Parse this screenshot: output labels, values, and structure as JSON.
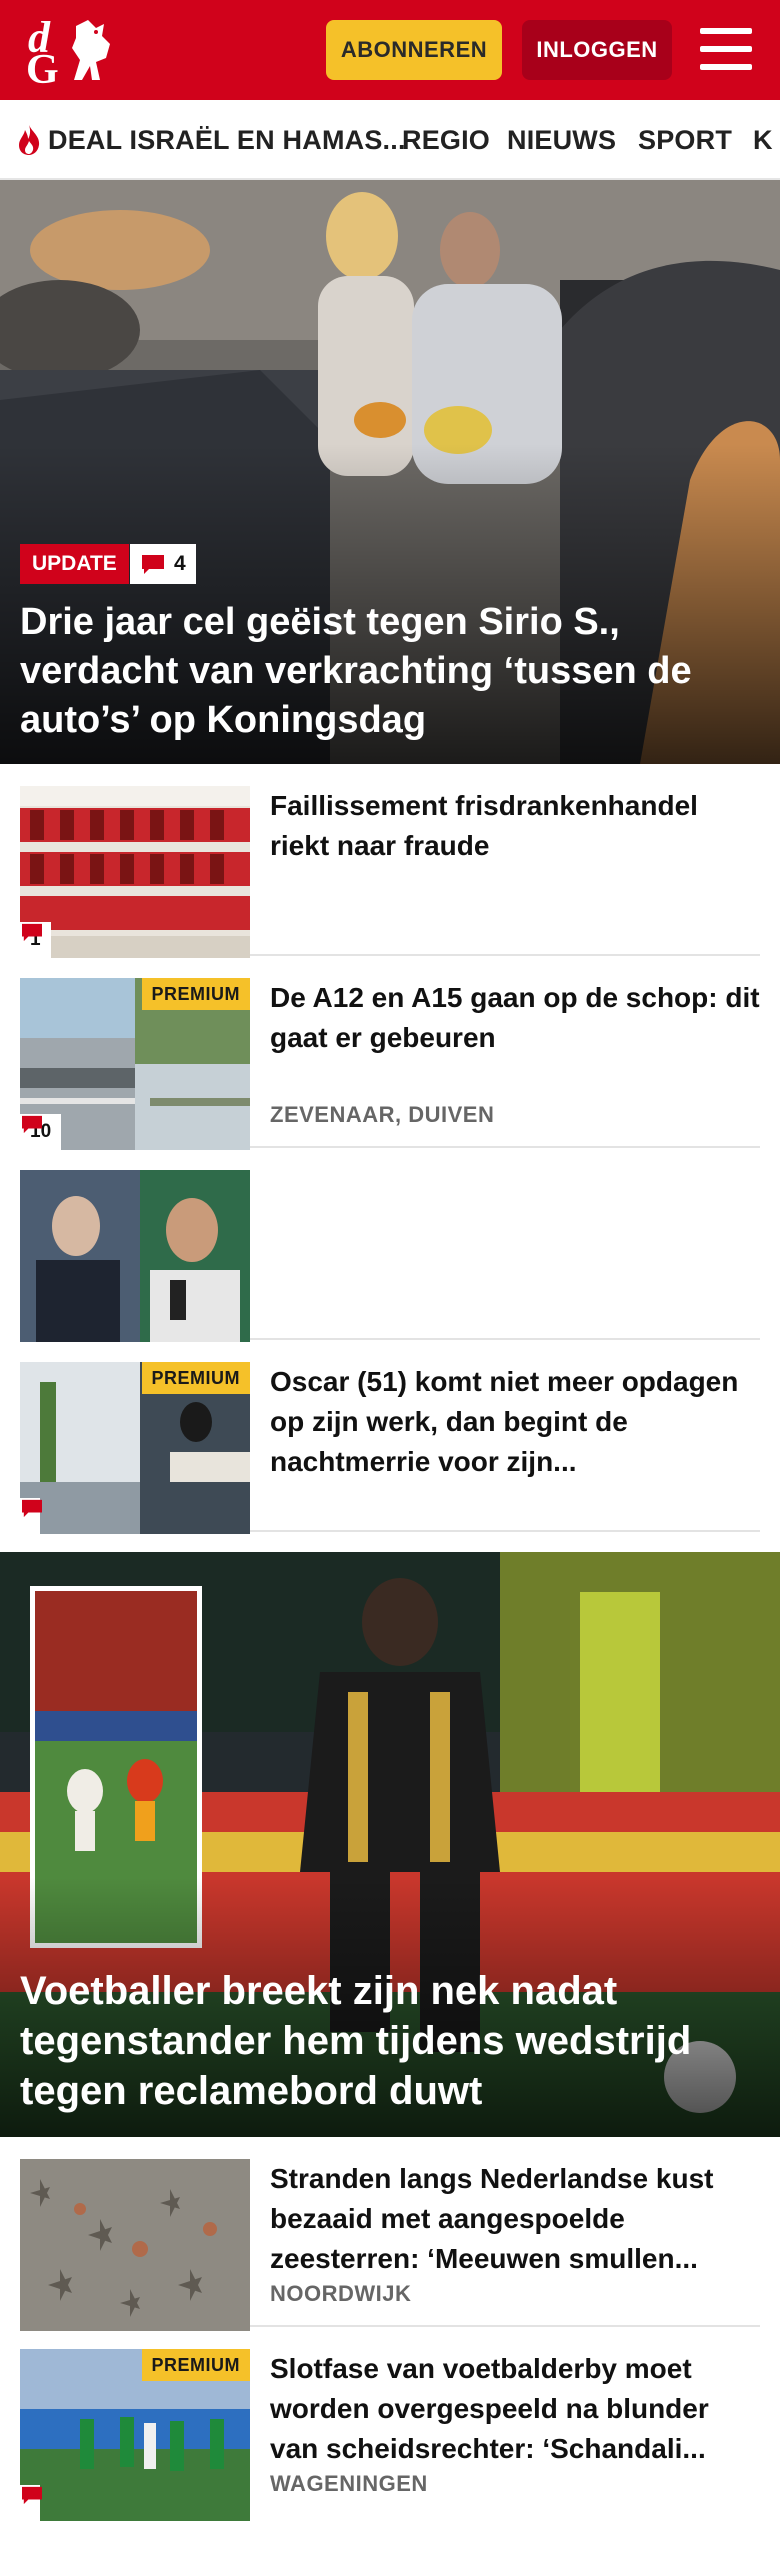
{
  "header": {
    "logo_letters": "dG",
    "subscribe_label": "ABONNEREN",
    "login_label": "INLOGGEN"
  },
  "nav": {
    "items": [
      {
        "label": "DEAL ISRAËL EN HAMAS..."
      },
      {
        "label": "REGIO"
      },
      {
        "label": "NIEUWS"
      },
      {
        "label": "SPORT"
      },
      {
        "label": "K"
      }
    ]
  },
  "hero": {
    "badge": "UPDATE",
    "comments": "4",
    "title": "Drie jaar cel geëist tegen Sirio S., verdacht van verkrachting ‘tussen de auto’s’ op Koningsdag"
  },
  "articles": [
    {
      "title": "Faillissement frisdrankenhandel riekt naar fraude",
      "comments": "1",
      "premium": "",
      "location": ""
    },
    {
      "title": "De A12 en A15 gaan op de schop: dit gaat er gebeuren",
      "comments": "10",
      "premium": "PREMIUM",
      "location": "ZEVENAAR, DUIVEN"
    },
    {
      "title": "",
      "comments": "",
      "premium": "",
      "location": ""
    },
    {
      "title": "Oscar (51) komt niet meer opdagen op zijn werk, dan begint de nachtmerrie voor zijn...",
      "comments": "",
      "premium": "PREMIUM",
      "location": ""
    }
  ],
  "feature": {
    "title": "Voetballer breekt zijn nek nadat tegenstander hem tijdens wedstrijd tegen reclamebord duwt"
  },
  "articles2": [
    {
      "title": "Stranden langs Nederlandse kust bezaaid met aangespoelde zeesterren: ‘Meeuwen smullen...",
      "comments": "",
      "premium": "",
      "location": "NOORDWIJK"
    },
    {
      "title": "Slotfase van voetbalderby moet worden overgespeeld na blunder van scheidsrechter: ‘Schandali...",
      "comments": "",
      "premium": "PREMIUM",
      "location": "WAGENINGEN"
    }
  ],
  "colors": {
    "brand_red": "#d0021b",
    "dark_red": "#a8001a",
    "yellow": "#f5c129"
  },
  "icons": [
    "flame-icon",
    "comment-icon",
    "menu-icon",
    "logo-horse-icon"
  ]
}
